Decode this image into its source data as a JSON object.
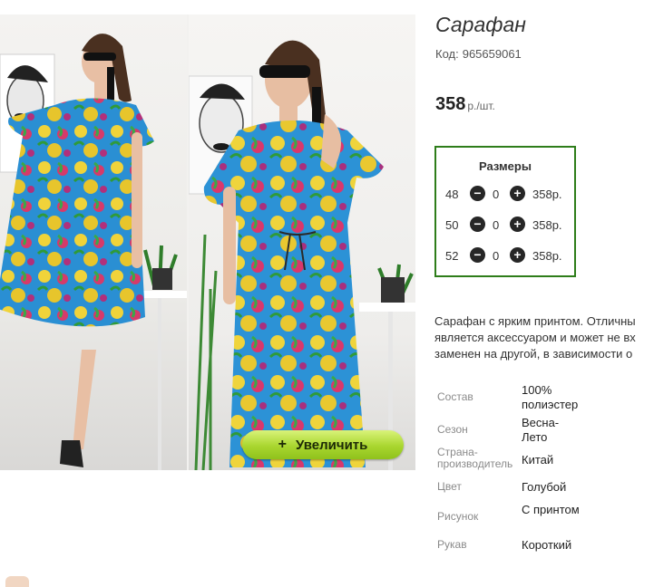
{
  "product": {
    "title": "Сарафан",
    "code_label": "Код:",
    "code_value": "965659061",
    "price": "358",
    "price_unit": "р./шт."
  },
  "gallery": {
    "zoom_label": "Увеличить",
    "zoom_icon": "plus-icon"
  },
  "sizes": {
    "title": "Размеры",
    "rows": [
      {
        "size": "48",
        "qty": "0",
        "price": "358р."
      },
      {
        "size": "50",
        "qty": "0",
        "price": "358р."
      },
      {
        "size": "52",
        "qty": "0",
        "price": "358р."
      }
    ]
  },
  "description": {
    "lines": [
      "Сарафан с ярким принтом. Отличны",
      "является аксессуаром и может не вх",
      "заменен на другой, в зависимости о"
    ]
  },
  "properties": [
    {
      "label": "Состав",
      "value": "100% полиэстер"
    },
    {
      "label": "Сезон",
      "value": "Весна-Лето"
    },
    {
      "label": "Страна-производитель",
      "value": "Китай"
    },
    {
      "label": "Цвет",
      "value": "Голубой"
    },
    {
      "label": "Рисунок",
      "value": "С принтом"
    },
    {
      "label": "Рукав",
      "value": "Короткий"
    }
  ],
  "colors": {
    "accent_border": "#2e7d1a",
    "zoom_button": "#a9d62f",
    "dress_base": "#2b8fd0"
  }
}
